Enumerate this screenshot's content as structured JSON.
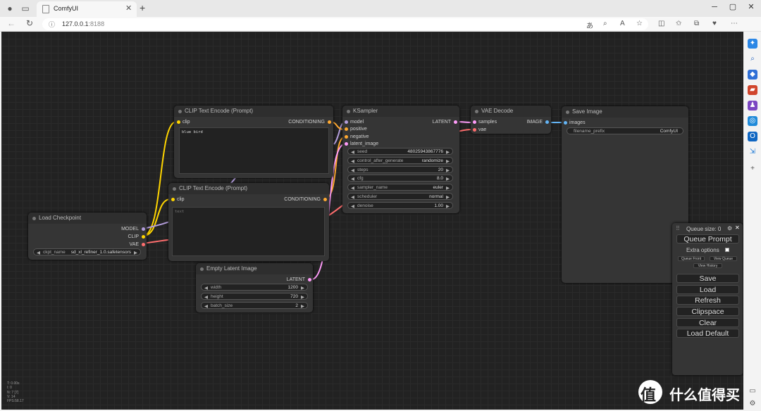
{
  "browser": {
    "tab_title": "ComfyUI",
    "url_host": "127.0.0.1",
    "url_port": ":8188"
  },
  "nodes": {
    "clip1": {
      "title": "CLIP Text Encode (Prompt)",
      "in_clip": "clip",
      "out": "CONDITIONING",
      "text": "blue bird"
    },
    "clip2": {
      "title": "CLIP Text Encode (Prompt)",
      "in_clip": "clip",
      "out": "CONDITIONING",
      "text": "text"
    },
    "ksampler": {
      "title": "KSampler",
      "inputs": [
        "model",
        "positive",
        "negative",
        "latent_image"
      ],
      "out": "LATENT",
      "widgets": [
        {
          "name": "seed",
          "value": "480259438677​76"
        },
        {
          "name": "control_after_generate",
          "value": "randomize"
        },
        {
          "name": "steps",
          "value": "20"
        },
        {
          "name": "cfg",
          "value": "8.0"
        },
        {
          "name": "sampler_name",
          "value": "euler"
        },
        {
          "name": "scheduler",
          "value": "normal"
        },
        {
          "name": "denoise",
          "value": "1.00"
        }
      ]
    },
    "vae": {
      "title": "VAE Decode",
      "inputs": [
        "samples",
        "vae"
      ],
      "out": "IMAGE"
    },
    "save": {
      "title": "Save Image",
      "in": "images",
      "widget_name": "filename_prefix",
      "widget_value": "ComfyUI"
    },
    "ckpt": {
      "title": "Load Checkpoint",
      "outs": [
        "MODEL",
        "CLIP",
        "VAE"
      ],
      "widget_name": "ckpt_name",
      "widget_value": "sd_xl_refiner_1.0.safetensors"
    },
    "latent": {
      "title": "Empty Latent Image",
      "out": "LATENT",
      "widgets": [
        {
          "name": "width",
          "value": "1200"
        },
        {
          "name": "height",
          "value": "720"
        },
        {
          "name": "batch_size",
          "value": "2"
        }
      ]
    }
  },
  "menu": {
    "queue_size": "Queue size: 0",
    "queue_prompt": "Queue Prompt",
    "extra_options": "Extra options",
    "queue_front": "Queue Front",
    "view_queue": "View Queue",
    "view_history": "View History",
    "save": "Save",
    "load": "Load",
    "refresh": "Refresh",
    "clipspace": "Clipspace",
    "clear": "Clear",
    "load_default": "Load Default"
  },
  "stats": [
    "T: 0.00s",
    "I: 0",
    "N: 7 [7]",
    "V: 14",
    "FPS:58.17"
  ],
  "watermark": "什么值得买",
  "colors": {
    "clip": "#ffd500",
    "conditioning": "#ffa931",
    "model": "#b39ddb",
    "vae": "#ff6e6e",
    "latent": "#ff9cf9",
    "image": "#64b5f6"
  }
}
